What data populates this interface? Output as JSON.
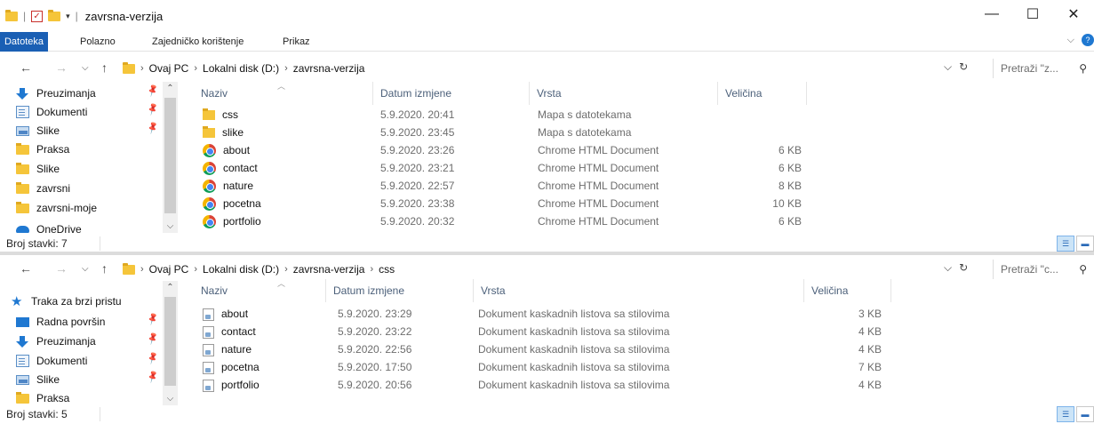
{
  "window": {
    "title": "zavrsna-verzija",
    "controls": {
      "minimize": "—",
      "maximize": "☐",
      "close": "✕"
    }
  },
  "ribbon": {
    "tabs": [
      "Datoteka",
      "Polazno",
      "Zajedničko korištenje",
      "Prikaz"
    ],
    "expand": "⌵",
    "help": "?"
  },
  "pane1": {
    "breadcrumbs": [
      "Ovaj PC",
      "Lokalni disk (D:)",
      "zavrsna-verzija"
    ],
    "search_placeholder": "Pretraži \"z...",
    "nav_items": [
      {
        "label": "Preuzimanja",
        "icon": "download-icon",
        "pinned": true
      },
      {
        "label": "Dokumenti",
        "icon": "documents-icon",
        "pinned": true
      },
      {
        "label": "Slike",
        "icon": "pictures-icon",
        "pinned": true
      },
      {
        "label": "Praksa",
        "icon": "folder-icon",
        "pinned": false
      },
      {
        "label": "Slike",
        "icon": "folder-icon",
        "pinned": false
      },
      {
        "label": "zavrsni",
        "icon": "folder-icon",
        "pinned": false
      },
      {
        "label": "zavrsni-moje",
        "icon": "folder-icon",
        "pinned": false
      },
      {
        "label": "OneDrive",
        "icon": "onedrive-icon",
        "pinned": false
      }
    ],
    "columns": {
      "name": "Naziv",
      "date": "Datum izmjene",
      "type": "Vrsta",
      "size": "Veličina"
    },
    "files": [
      {
        "name": "css",
        "date": "5.9.2020. 20:41",
        "type": "Mapa s datotekama",
        "size": "",
        "icon": "folder"
      },
      {
        "name": "slike",
        "date": "5.9.2020. 23:45",
        "type": "Mapa s datotekama",
        "size": "",
        "icon": "folder"
      },
      {
        "name": "about",
        "date": "5.9.2020. 23:26",
        "type": "Chrome HTML Document",
        "size": "6 KB",
        "icon": "chrome"
      },
      {
        "name": "contact",
        "date": "5.9.2020. 23:21",
        "type": "Chrome HTML Document",
        "size": "6 KB",
        "icon": "chrome"
      },
      {
        "name": "nature",
        "date": "5.9.2020. 22:57",
        "type": "Chrome HTML Document",
        "size": "8 KB",
        "icon": "chrome"
      },
      {
        "name": "pocetna",
        "date": "5.9.2020. 23:38",
        "type": "Chrome HTML Document",
        "size": "10 KB",
        "icon": "chrome"
      },
      {
        "name": "portfolio",
        "date": "5.9.2020. 20:32",
        "type": "Chrome HTML Document",
        "size": "6 KB",
        "icon": "chrome"
      }
    ],
    "status": "Broj stavki: 7"
  },
  "pane2": {
    "breadcrumbs": [
      "Ovaj PC",
      "Lokalni disk (D:)",
      "zavrsna-verzija",
      "css"
    ],
    "search_placeholder": "Pretraži \"c...",
    "nav_items": [
      {
        "label": "Traka za brzi pristu",
        "icon": "star-icon",
        "pinned": false
      },
      {
        "label": "Radna površin",
        "icon": "desktop-icon",
        "pinned": true
      },
      {
        "label": "Preuzimanja",
        "icon": "download-icon",
        "pinned": true
      },
      {
        "label": "Dokumenti",
        "icon": "documents-icon",
        "pinned": true
      },
      {
        "label": "Slike",
        "icon": "pictures-icon",
        "pinned": true
      },
      {
        "label": "Praksa",
        "icon": "folder-icon",
        "pinned": false
      }
    ],
    "columns": {
      "name": "Naziv",
      "date": "Datum izmjene",
      "type": "Vrsta",
      "size": "Veličina"
    },
    "files": [
      {
        "name": "about",
        "date": "5.9.2020. 23:29",
        "type": "Dokument kaskadnih listova sa stilovima",
        "size": "3 KB"
      },
      {
        "name": "contact",
        "date": "5.9.2020. 23:22",
        "type": "Dokument kaskadnih listova sa stilovima",
        "size": "4 KB"
      },
      {
        "name": "nature",
        "date": "5.9.2020. 22:56",
        "type": "Dokument kaskadnih listova sa stilovima",
        "size": "4 KB"
      },
      {
        "name": "pocetna",
        "date": "5.9.2020. 17:50",
        "type": "Dokument kaskadnih listova sa stilovima",
        "size": "7 KB"
      },
      {
        "name": "portfolio",
        "date": "5.9.2020. 20:56",
        "type": "Dokument kaskadnih listova sa stilovima",
        "size": "4 KB"
      }
    ],
    "status": "Broj stavki: 5"
  }
}
